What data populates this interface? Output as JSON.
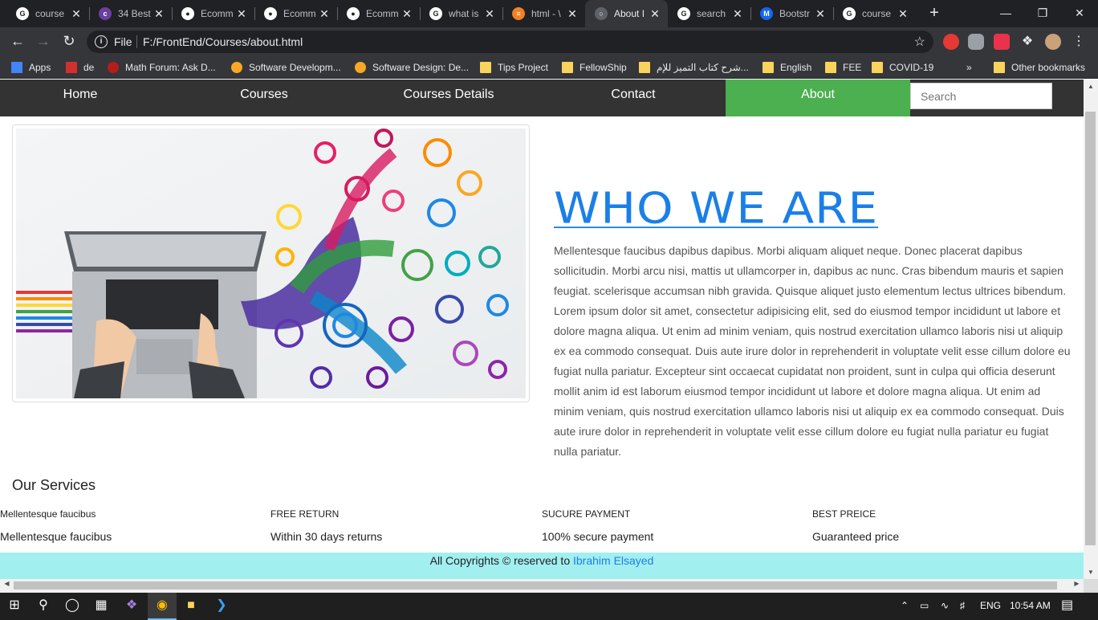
{
  "browser": {
    "tabs": [
      {
        "title": "course",
        "favicon": "google-icon"
      },
      {
        "title": "34 Best",
        "favicon": "colorlib-icon"
      },
      {
        "title": "Ecomm",
        "favicon": "github-icon"
      },
      {
        "title": "Ecomm",
        "favicon": "github-icon"
      },
      {
        "title": "Ecomm",
        "favicon": "github-icon"
      },
      {
        "title": "what is",
        "favicon": "google-icon"
      },
      {
        "title": "html - \\",
        "favicon": "stackoverflow-icon"
      },
      {
        "title": "About I",
        "favicon": "globe-icon",
        "active": true
      },
      {
        "title": "search",
        "favicon": "google-icon"
      },
      {
        "title": "Bootstr",
        "favicon": "mdb-icon"
      },
      {
        "title": "course",
        "favicon": "google-icon"
      }
    ],
    "omnibox": {
      "scheme_label": "File",
      "url": "F:/FrontEnd/Courses/about.html"
    },
    "bookmarks": [
      {
        "label": "Apps",
        "icon": "apps-grid-icon"
      },
      {
        "label": "de",
        "icon": "red-icon"
      },
      {
        "label": "Math Forum: Ask D...",
        "icon": "math-icon"
      },
      {
        "label": "Software Developm...",
        "icon": "software-icon"
      },
      {
        "label": "Software Design: De...",
        "icon": "software-icon"
      },
      {
        "label": "Tips Project",
        "icon": "folder-icon"
      },
      {
        "label": "FellowShip",
        "icon": "folder-icon"
      },
      {
        "label": "شرح كتاب التميز للإم...",
        "icon": "folder-icon"
      },
      {
        "label": "English",
        "icon": "folder-icon"
      },
      {
        "label": "FEE",
        "icon": "folder-icon"
      },
      {
        "label": "COVID-19",
        "icon": "folder-icon"
      }
    ],
    "more_bookmarks": "»",
    "other_bookmarks": "Other bookmarks"
  },
  "site": {
    "nav": [
      {
        "label": "Home"
      },
      {
        "label": "Courses"
      },
      {
        "label": "Courses Details"
      },
      {
        "label": "Contact"
      },
      {
        "label": "About",
        "active": true
      }
    ],
    "search_placeholder": "Search",
    "heading": "WHO WE ARE",
    "paragraph": "Mellentesque faucibus dapibus dapibus. Morbi aliquam aliquet neque. Donec placerat dapibus sollicitudin. Morbi arcu nisi, mattis ut ullamcorper in, dapibus ac nunc. Cras bibendum mauris et sapien feugiat. scelerisque accumsan nibh gravida. Quisque aliquet justo elementum lectus ultrices bibendum. Lorem ipsum dolor sit amet, consectetur adipisicing elit, sed do eiusmod tempor incididunt ut labore et dolore magna aliqua. Ut enim ad minim veniam, quis nostrud exercitation ullamco laboris nisi ut aliquip ex ea commodo consequat. Duis aute irure dolor in reprehenderit in voluptate velit esse cillum dolore eu fugiat nulla pariatur. Excepteur sint occaecat cupidatat non proident, sunt in culpa qui officia deserunt mollit anim id est laborum eiusmod tempor incididunt ut labore et dolore magna aliqua. Ut enim ad minim veniam, quis nostrud exercitation ullamco laboris nisi ut aliquip ex ea commodo consequat. Duis aute irure dolor in reprehenderit in voluptate velit esse cillum dolore eu fugiat nulla pariatur eu fugiat nulla pariatur.",
    "services_title": "Our Services",
    "services": [
      {
        "heading": "Mellentesque faucibus",
        "detail": "Mellentesque faucibus"
      },
      {
        "heading": "FREE RETURN",
        "detail": "Within 30 days returns"
      },
      {
        "heading": "SUCURE PAYMENT",
        "detail": "100% secure payment"
      },
      {
        "heading": "BEST PREICE",
        "detail": "Guaranteed price"
      }
    ],
    "footer": {
      "text": "All Copyrights © reserved to ",
      "author": "Ibrahim Elsayed"
    },
    "colors": {
      "nav_bg": "#333333",
      "nav_active": "#4caf50",
      "heading": "#1a7fe8",
      "footer_bg": "#a2eff0"
    }
  },
  "taskbar": {
    "language": "ENG",
    "time": "10:54 AM"
  }
}
